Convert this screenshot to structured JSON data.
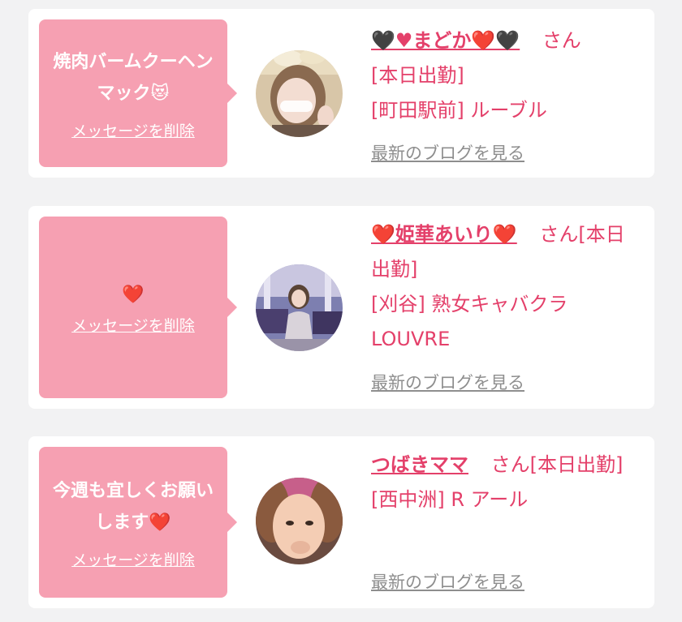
{
  "colors": {
    "page_bg": "#f2f2f3",
    "card_bg": "#ffffff",
    "bubble_bg": "#f6a0b2",
    "accent_pink": "#e4406a",
    "link_gray": "#8e8e8e"
  },
  "messages": [
    {
      "message": "焼肉バームクーヘンマック😻",
      "delete_label": "メッセージを削除",
      "name": "🖤♥まどか❤️🖤",
      "suffix": "さん",
      "line2": "[本日出勤]",
      "line3": "[町田駅前] ルーブル",
      "blog_label": "最新のブログを見る",
      "avatar_icon": "woman-photo-avatar"
    },
    {
      "message": "❤️",
      "delete_label": "メッセージを削除",
      "name": "❤️姫華あいり❤️",
      "suffix": "さん[本日出勤]",
      "line2": "[刈谷] 熟女キャバクラLOUVRE",
      "line3": "",
      "blog_label": "最新のブログを見る",
      "avatar_icon": "woman-photo-avatar"
    },
    {
      "message": "今週も宜しくお願いします❤️",
      "delete_label": "メッセージを削除",
      "name": "つばきママ",
      "suffix": "さん[本日出勤]",
      "line2": "[西中洲] R アール",
      "line3": "",
      "blog_label": "最新のブログを見る",
      "avatar_icon": "woman-photo-avatar"
    }
  ]
}
